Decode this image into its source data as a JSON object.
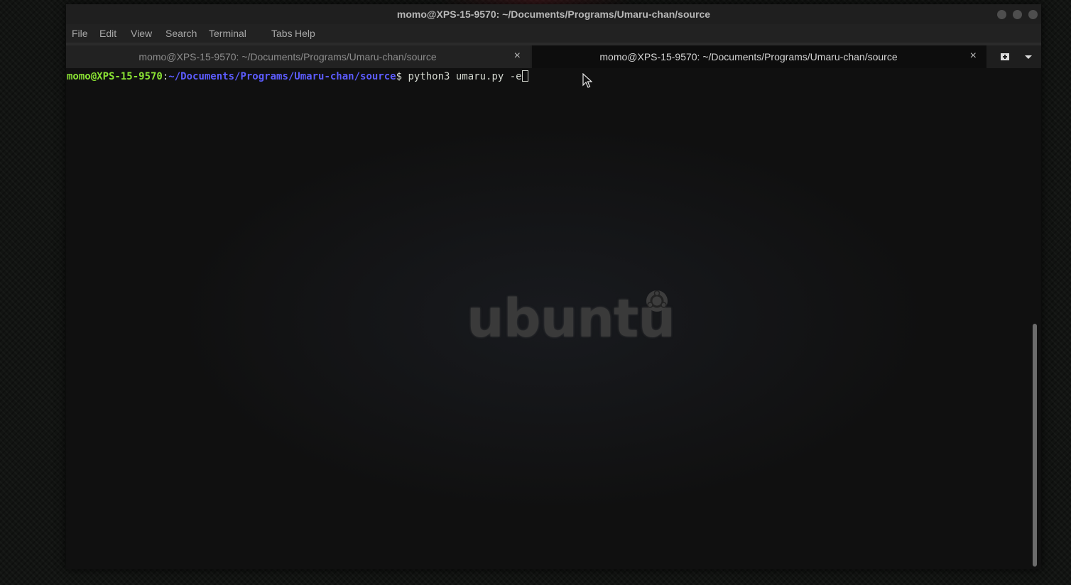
{
  "window": {
    "title": "momo@XPS-15-9570: ~/Documents/Programs/Umaru-chan/source"
  },
  "menu": {
    "file": "File",
    "edit": "Edit",
    "view": "View",
    "search": "Search",
    "terminal": "Terminal",
    "tabs": "Tabs",
    "help": "Help"
  },
  "tabs": [
    {
      "label": "momo@XPS-15-9570: ~/Documents/Programs/Umaru-chan/source",
      "close": "×",
      "active": false
    },
    {
      "label": "momo@XPS-15-9570: ~/Documents/Programs/Umaru-chan/source",
      "close": "×",
      "active": true
    }
  ],
  "tabbar_icons": {
    "new_tab": "new-tab-icon",
    "tab_menu": "chevron-down-icon"
  },
  "terminal": {
    "prompt_user": "momo@XPS-15-9570",
    "prompt_colon": ":",
    "prompt_path": "~/Documents/Programs/Umaru-chan/source",
    "prompt_dollar": "$ ",
    "command": "python3 umaru.py -e"
  },
  "wallpaper": {
    "logo_text": "ubuntu"
  },
  "colors": {
    "prompt_user": "#8ae234",
    "prompt_path": "#5c5cff",
    "terminal_bg": "#101010",
    "titlebar_bg": "#1f1f1f"
  }
}
